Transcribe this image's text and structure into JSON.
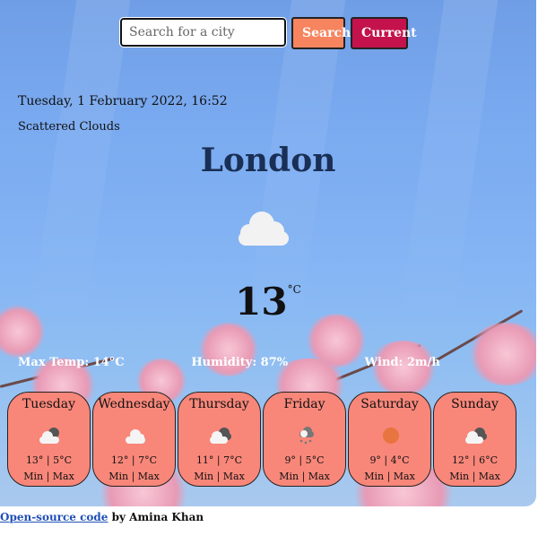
{
  "search": {
    "placeholder": "Search for a city",
    "value": ""
  },
  "buttons": {
    "search_label": "Search",
    "current_label": "Current"
  },
  "current": {
    "datetime": "Tuesday, 1 February 2022, 16:52",
    "description": "Scattered Clouds",
    "city": "London",
    "temperature": "13",
    "unit": "°C",
    "icon": "cloud-icon"
  },
  "stats": {
    "max_temp": "Max Temp: 14°C",
    "humidity": "Humidity: 87%",
    "wind": "Wind: 2m/h"
  },
  "forecast": [
    {
      "day": "Tuesday",
      "icon": "sun-cloud-icon",
      "temps": "13° | 5°C",
      "minmax": "Min | Max"
    },
    {
      "day": "Wednesday",
      "icon": "cloud-icon",
      "temps": "12° | 7°C",
      "minmax": "Min | Max"
    },
    {
      "day": "Thursday",
      "icon": "dark-cloud-icon",
      "temps": "11° | 7°C",
      "minmax": "Min | Max"
    },
    {
      "day": "Friday",
      "icon": "rain-cloud-icon",
      "temps": "9° | 5°C",
      "minmax": "Min | Max"
    },
    {
      "day": "Saturday",
      "icon": "sun-icon",
      "temps": "9° | 4°C",
      "minmax": "Min | Max"
    },
    {
      "day": "Sunday",
      "icon": "dark-cloud-icon",
      "temps": "12° | 6°C",
      "minmax": "Min | Max"
    }
  ],
  "footer": {
    "link_text": "Open-source code",
    "suffix": " by Amina Khan"
  },
  "colors": {
    "search_button": "#f6855f",
    "current_button": "#c4124d",
    "forecast_card": "#f8877a",
    "city_text": "#1a2f55"
  }
}
